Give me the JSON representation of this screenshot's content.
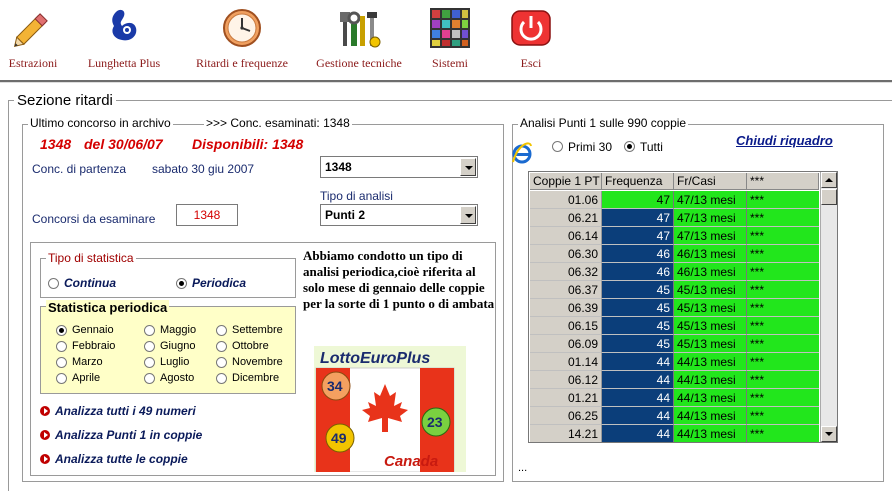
{
  "toolbar": {
    "items": [
      {
        "label": "Estrazioni",
        "icon": "pencil-icon"
      },
      {
        "label": "Lunghetta Plus",
        "icon": "lottery-hand-icon"
      },
      {
        "label": "Ritardi e frequenze",
        "icon": "clock-icon"
      },
      {
        "label": "Gestione tecniche",
        "icon": "tools-icon"
      },
      {
        "label": "Sistemi",
        "icon": "grid-icon"
      },
      {
        "label": "Esci",
        "icon": "power-icon"
      }
    ]
  },
  "section": {
    "title": "Sezione ritardi"
  },
  "archive": {
    "group_title": "Ultimo concorso in archivo",
    "examined": ">>> Conc. esaminati: 1348",
    "last_number": "1348",
    "last_date": "del 30/06/07",
    "available": "Disponibili: 1348",
    "start_label": "Conc. di partenza",
    "start_date": "sabato 30 giu 2007",
    "start_combo": "1348",
    "analysis_type_label": "Tipo di analisi",
    "analysis_type_value": "Punti 2",
    "count_label": "Concorsi da esaminare",
    "count_value": "1348"
  },
  "stat_type": {
    "title": "Tipo di statistica",
    "options": [
      "Continua",
      "Periodica"
    ],
    "selected": "Periodica"
  },
  "periodic": {
    "title": "Statistica periodica",
    "months": [
      "Gennaio",
      "Febbraio",
      "Marzo",
      "Aprile",
      "Maggio",
      "Giugno",
      "Luglio",
      "Agosto",
      "Settembre",
      "Ottobre",
      "Novembre",
      "Dicembre"
    ],
    "selected": "Gennaio"
  },
  "description": {
    "text": "Abbiamo condotto un tipo di analisi periodica,cioè riferita al solo mese di gennaio delle coppie per la sorte di 1 punto o di ambata"
  },
  "logo": {
    "title": "LottoEuroPlus",
    "subtitle": "Canada",
    "balls": [
      "34",
      "49",
      "23"
    ]
  },
  "actions": [
    "Analizza tutti i 49 numeri",
    "Analizza Punti 1 in coppie",
    "Analizza tutte le coppie"
  ],
  "right_panel": {
    "group_title": "Analisi Punti 1 sulle 990 coppie",
    "close_link": "Chiudi riquadro",
    "radio_first": "Primi 30",
    "radio_all": "Tutti",
    "radio_selected": "Tutti",
    "footer": "...",
    "ie_icon": "internet-explorer-icon"
  },
  "table": {
    "headers": [
      "Coppie 1 PT",
      "Frequenza",
      "Fr/Casi",
      "***"
    ],
    "rows": [
      {
        "pair": "01.06",
        "freq": "47",
        "frcasi": "47/13 mesi",
        "star": "***",
        "highlight": true
      },
      {
        "pair": "06.21",
        "freq": "47",
        "frcasi": "47/13 mesi",
        "star": "***",
        "highlight": false
      },
      {
        "pair": "06.14",
        "freq": "47",
        "frcasi": "47/13 mesi",
        "star": "***",
        "highlight": false
      },
      {
        "pair": "06.30",
        "freq": "46",
        "frcasi": "46/13 mesi",
        "star": "***",
        "highlight": false
      },
      {
        "pair": "06.32",
        "freq": "46",
        "frcasi": "46/13 mesi",
        "star": "***",
        "highlight": false
      },
      {
        "pair": "06.37",
        "freq": "45",
        "frcasi": "45/13 mesi",
        "star": "***",
        "highlight": false
      },
      {
        "pair": "06.39",
        "freq": "45",
        "frcasi": "45/13 mesi",
        "star": "***",
        "highlight": false
      },
      {
        "pair": "06.15",
        "freq": "45",
        "frcasi": "45/13 mesi",
        "star": "***",
        "highlight": false
      },
      {
        "pair": "06.09",
        "freq": "45",
        "frcasi": "45/13 mesi",
        "star": "***",
        "highlight": false
      },
      {
        "pair": "01.14",
        "freq": "44",
        "frcasi": "44/13 mesi",
        "star": "***",
        "highlight": false
      },
      {
        "pair": "06.12",
        "freq": "44",
        "frcasi": "44/13 mesi",
        "star": "***",
        "highlight": false
      },
      {
        "pair": "01.21",
        "freq": "44",
        "frcasi": "44/13 mesi",
        "star": "***",
        "highlight": false
      },
      {
        "pair": "06.25",
        "freq": "44",
        "frcasi": "44/13 mesi",
        "star": "***",
        "highlight": false
      },
      {
        "pair": "14.21",
        "freq": "44",
        "frcasi": "44/13 mesi",
        "star": "***",
        "highlight": false
      }
    ]
  },
  "colors": {
    "accent_red": "#d40000",
    "toolbar_label": "#8b1a1a",
    "cell_green": "#22e61c",
    "cell_navy": "#0b3e7a"
  }
}
